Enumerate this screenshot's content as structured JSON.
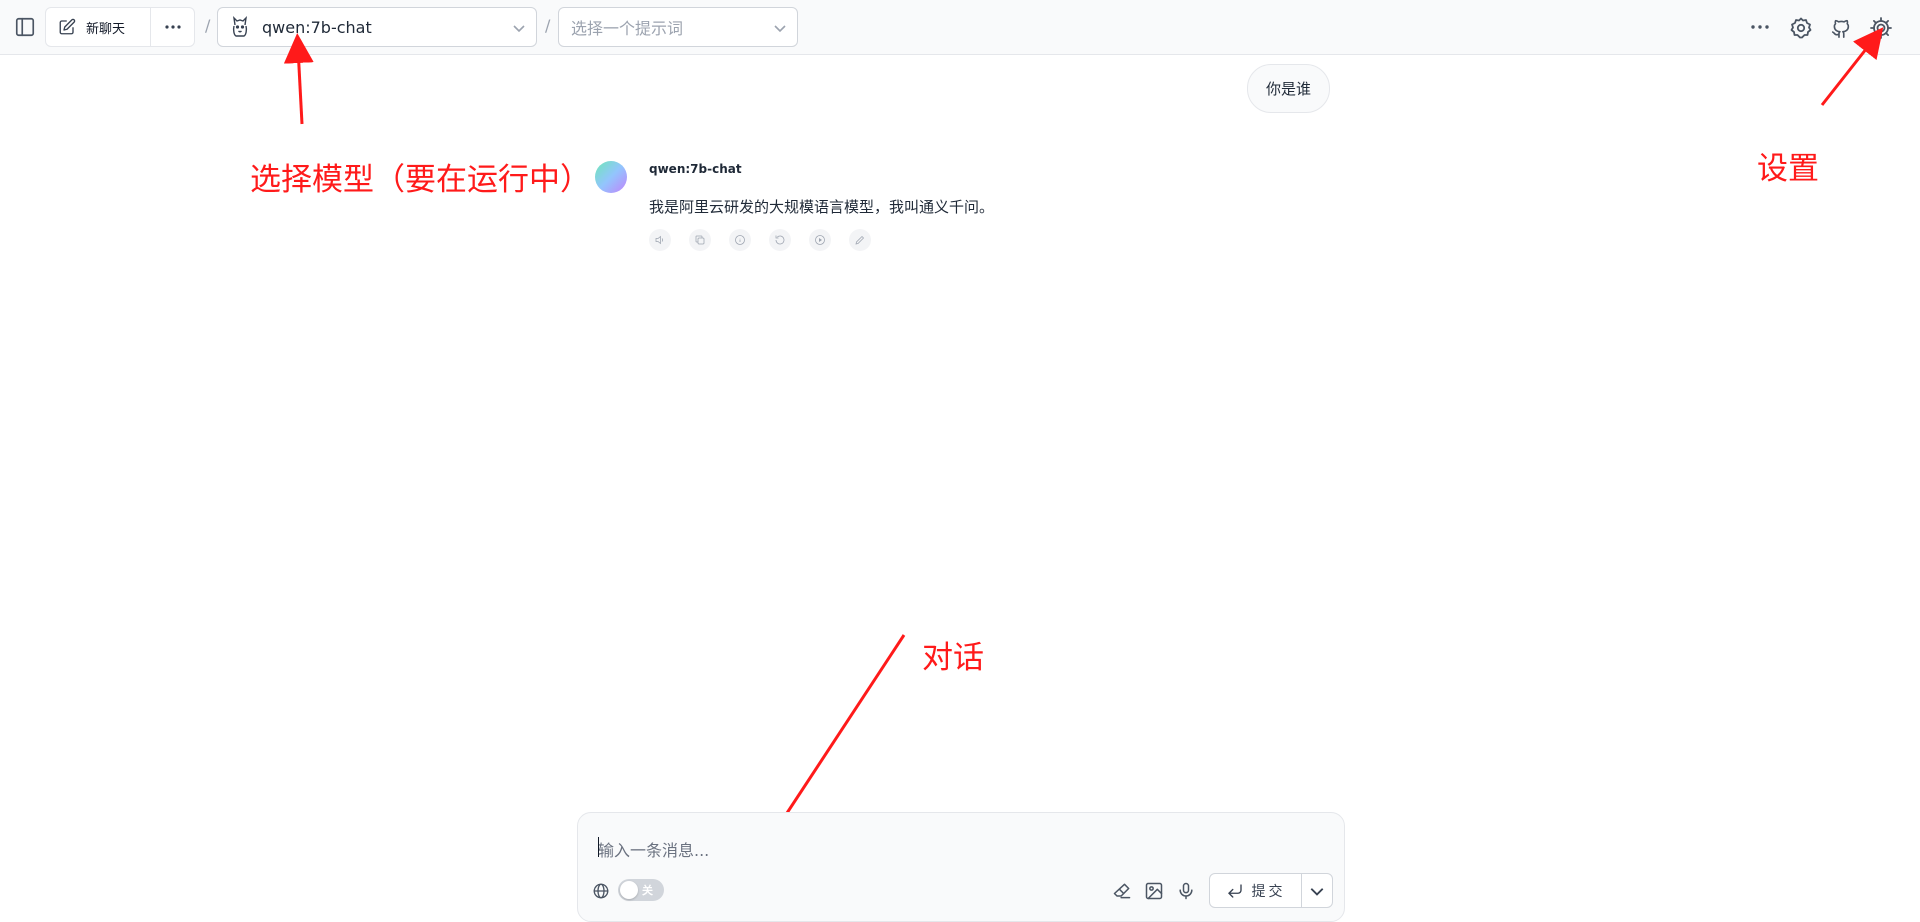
{
  "header": {
    "new_chat_label": "新聊天",
    "model_value": "qwen:7b-chat",
    "prompt_placeholder": "选择一个提示词",
    "separator": "/"
  },
  "chat": {
    "user_message": "你是谁",
    "assistant_name": "qwen:7b-chat",
    "assistant_reply": "我是阿里云研发的大规模语言模型，我叫通义千问。",
    "action_icons": [
      "speaker-icon",
      "copy-icon",
      "info-icon",
      "regenerate-icon",
      "play-icon",
      "edit-icon"
    ]
  },
  "annotations": {
    "select_model": "选择模型（要在运行中）",
    "settings": "设置",
    "dialog": "对话"
  },
  "composer": {
    "placeholder": "输入一条消息...",
    "toggle_label": "关",
    "submit_label": "提交"
  },
  "colors": {
    "annotation": "#ff1a1a",
    "topbar_bg": "#f9fafb",
    "border": "#e5e7eb"
  }
}
